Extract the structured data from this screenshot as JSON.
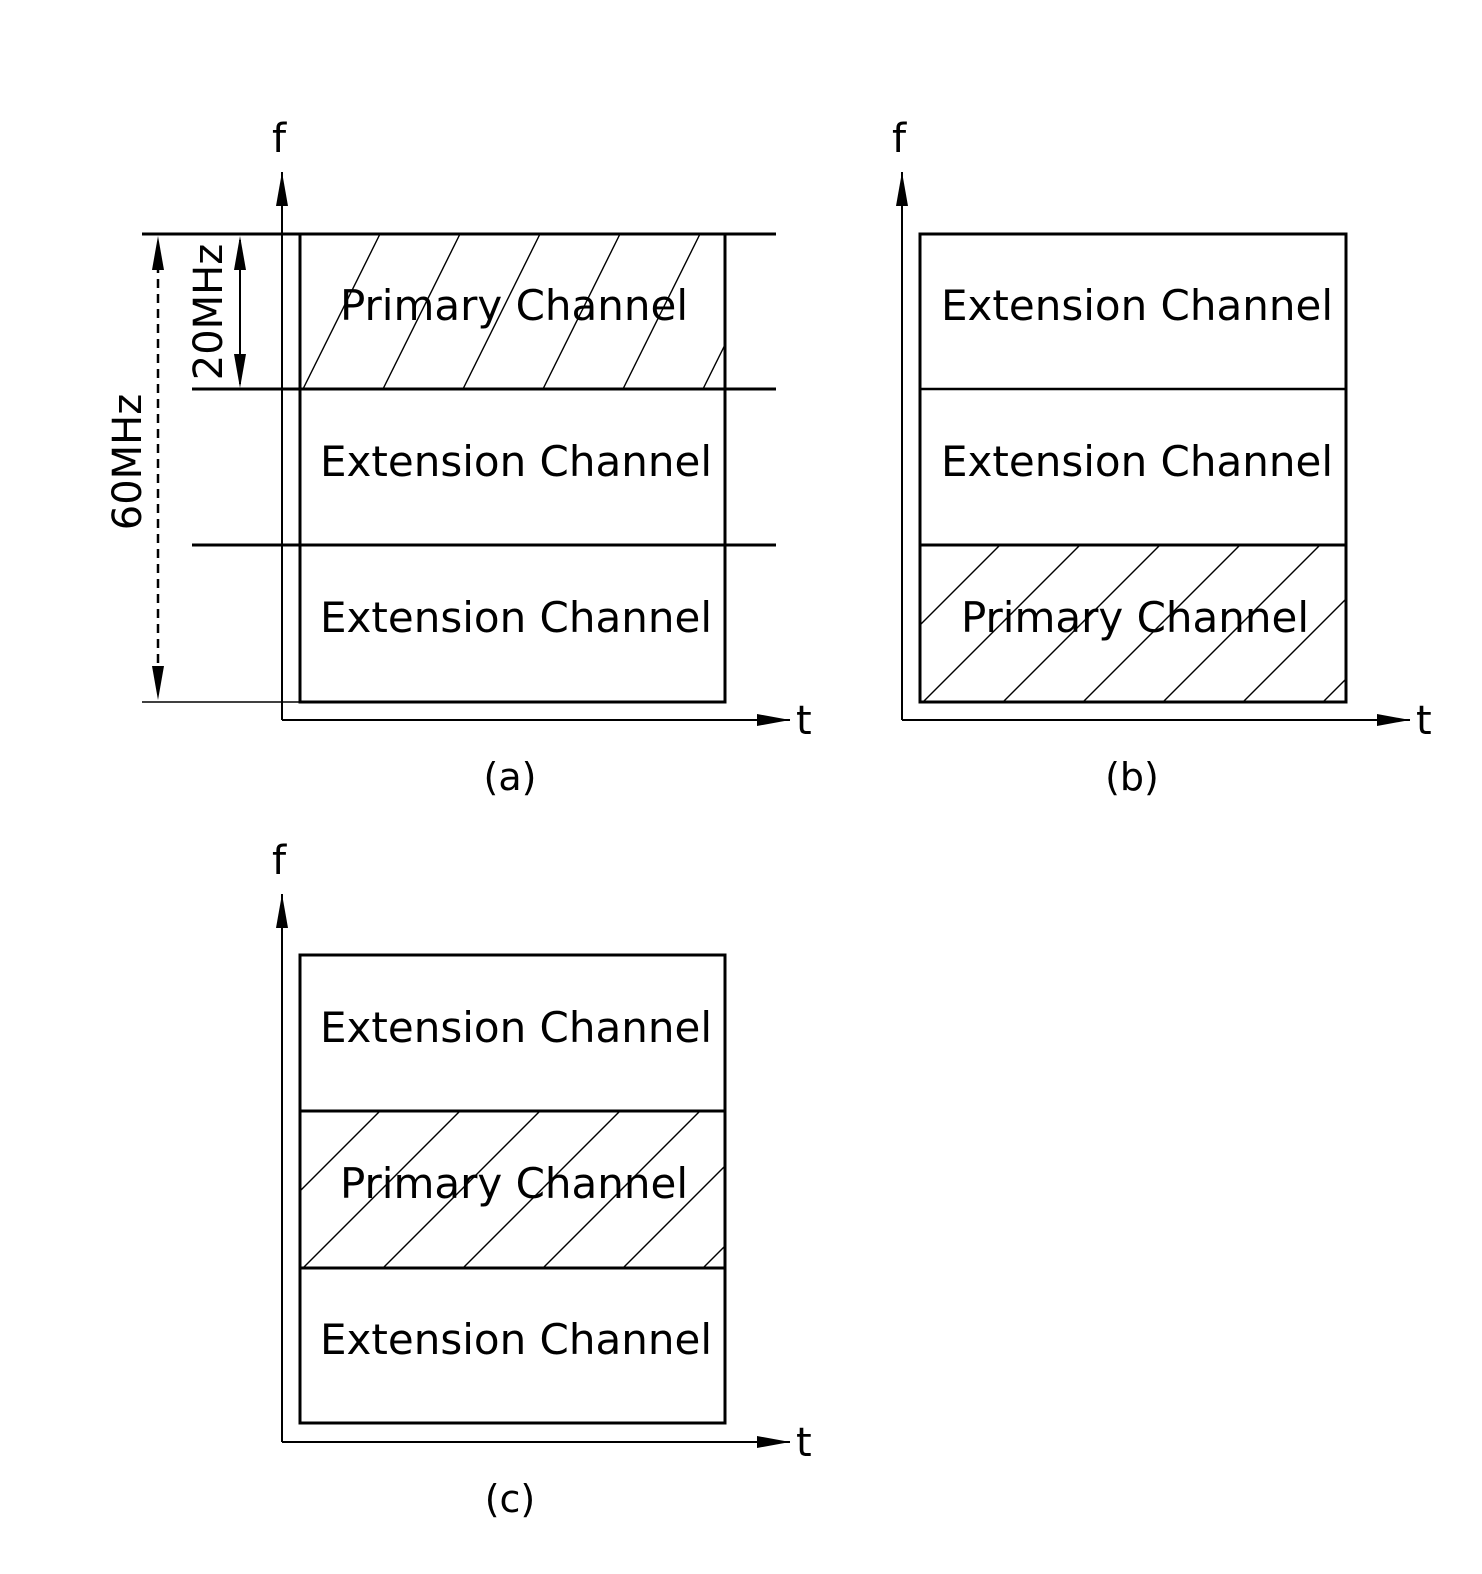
{
  "figure": {
    "panels": [
      {
        "id": "a",
        "caption": "(a)",
        "axis_y_label": "f",
        "axis_x_label": "t",
        "channels": [
          {
            "label": "Primary Channel",
            "type": "primary"
          },
          {
            "label": "Extension Channel",
            "type": "extension"
          },
          {
            "label": "Extension Channel",
            "type": "extension"
          }
        ],
        "dimensions": {
          "channel_width": "20MHz",
          "total_width": "60MHz"
        }
      },
      {
        "id": "b",
        "caption": "(b)",
        "axis_y_label": "f",
        "axis_x_label": "t",
        "channels": [
          {
            "label": "Extension Channel",
            "type": "extension"
          },
          {
            "label": "Extension Channel",
            "type": "extension"
          },
          {
            "label": "Primary Channel",
            "type": "primary"
          }
        ]
      },
      {
        "id": "c",
        "caption": "(c)",
        "axis_y_label": "f",
        "axis_x_label": "t",
        "channels": [
          {
            "label": "Extension Channel",
            "type": "extension"
          },
          {
            "label": "Primary Channel",
            "type": "primary"
          },
          {
            "label": "Extension Channel",
            "type": "extension"
          }
        ]
      }
    ]
  }
}
